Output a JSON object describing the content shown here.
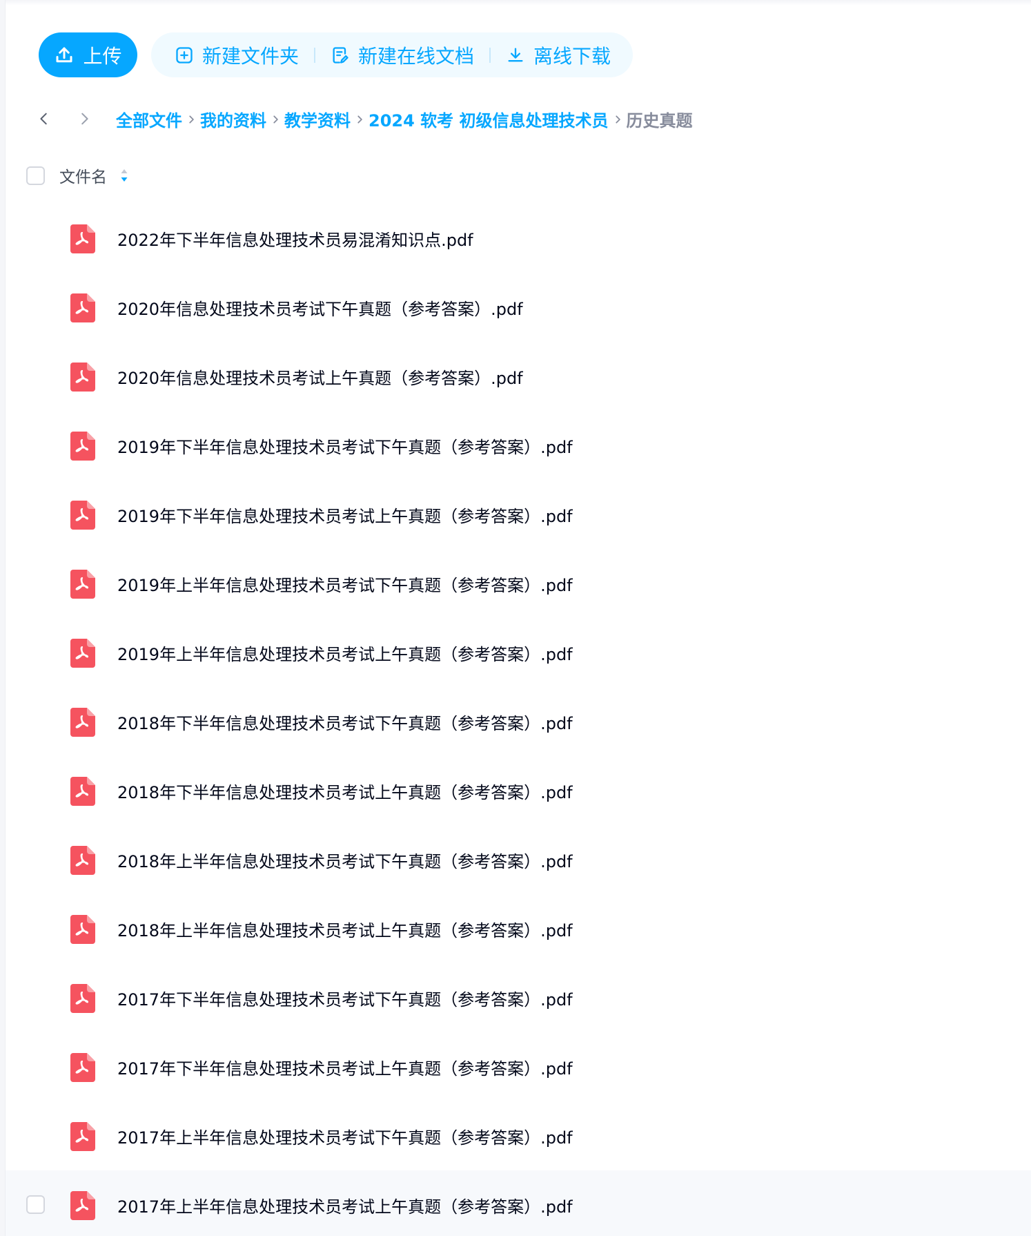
{
  "toolbar": {
    "upload_label": "上传",
    "new_folder_label": "新建文件夹",
    "new_doc_label": "新建在线文档",
    "offline_download_label": "离线下载"
  },
  "breadcrumb": {
    "items": [
      "全部文件",
      "我的资料",
      "教学资料",
      "2024 软考 初级信息处理技术员"
    ],
    "current": "历史真题"
  },
  "list_header": {
    "name_column": "文件名"
  },
  "files": [
    {
      "name": "2022年下半年信息处理技术员易混淆知识点.pdf",
      "type": "pdf"
    },
    {
      "name": "2020年信息处理技术员考试下午真题（参考答案）.pdf",
      "type": "pdf"
    },
    {
      "name": "2020年信息处理技术员考试上午真题（参考答案）.pdf",
      "type": "pdf"
    },
    {
      "name": "2019年下半年信息处理技术员考试下午真题（参考答案）.pdf",
      "type": "pdf"
    },
    {
      "name": "2019年下半年信息处理技术员考试上午真题（参考答案）.pdf",
      "type": "pdf"
    },
    {
      "name": "2019年上半年信息处理技术员考试下午真题（参考答案）.pdf",
      "type": "pdf"
    },
    {
      "name": "2019年上半年信息处理技术员考试上午真题（参考答案）.pdf",
      "type": "pdf"
    },
    {
      "name": "2018年下半年信息处理技术员考试下午真题（参考答案）.pdf",
      "type": "pdf"
    },
    {
      "name": "2018年下半年信息处理技术员考试上午真题（参考答案）.pdf",
      "type": "pdf"
    },
    {
      "name": "2018年上半年信息处理技术员考试下午真题（参考答案）.pdf",
      "type": "pdf"
    },
    {
      "name": "2018年上半年信息处理技术员考试上午真题（参考答案）.pdf",
      "type": "pdf"
    },
    {
      "name": "2017年下半年信息处理技术员考试下午真题（参考答案）.pdf",
      "type": "pdf"
    },
    {
      "name": "2017年下半年信息处理技术员考试上午真题（参考答案）.pdf",
      "type": "pdf"
    },
    {
      "name": "2017年上半年信息处理技术员考试下午真题（参考答案）.pdf",
      "type": "pdf"
    },
    {
      "name": "2017年上半年信息处理技术员考试上午真题（参考答案）.pdf",
      "type": "pdf",
      "hovered": true
    }
  ],
  "colors": {
    "accent": "#06a7ff",
    "accent_light_bg": "#f0faff",
    "pdf_red": "#f5535f",
    "text_primary": "#03081a",
    "text_muted": "#878c9c"
  },
  "icons": {
    "upload": "upload-icon",
    "new_folder": "folder-plus-icon",
    "new_doc": "edit-doc-icon",
    "offline_download": "download-icon",
    "back": "chevron-left-icon",
    "forward": "chevron-right-icon",
    "sort": "sort-icon",
    "file": "pdf-file-icon"
  }
}
